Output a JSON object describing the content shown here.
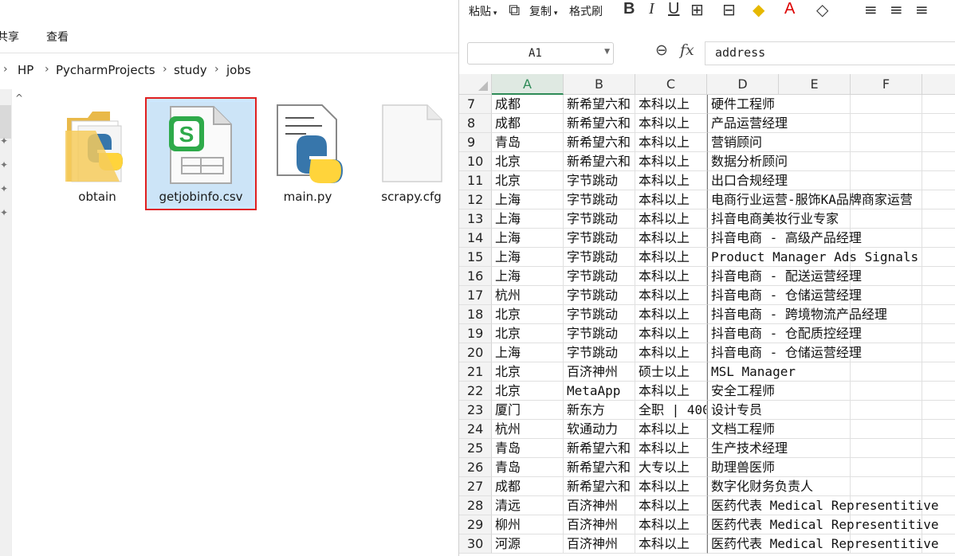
{
  "explorer": {
    "tabs": [
      "共享",
      "查看"
    ],
    "breadcrumb": [
      "HP",
      "PycharmProjects",
      "study",
      "jobs"
    ],
    "files": [
      {
        "name": "obtain",
        "icon": "python-folder-icon"
      },
      {
        "name": "getjobinfo.csv",
        "icon": "csv-spreadsheet-icon",
        "selected": true
      },
      {
        "name": "main.py",
        "icon": "python-file-icon"
      },
      {
        "name": "scrapy.cfg",
        "icon": "blank-file-icon"
      }
    ]
  },
  "spreadsheet": {
    "toolbar": {
      "paste": "粘贴",
      "copy": "复制",
      "format_painter": "格式刷"
    },
    "name_box": "A1",
    "formula_value": "address",
    "columns": [
      "A",
      "B",
      "C",
      "D",
      "E",
      "F"
    ],
    "rows": [
      {
        "n": "7",
        "a": "成都",
        "b": "新希望六和",
        "c": "本科以上",
        "d": "硬件工程师"
      },
      {
        "n": "8",
        "a": "成都",
        "b": "新希望六和",
        "c": "本科以上",
        "d": "产品运营经理"
      },
      {
        "n": "9",
        "a": "青岛",
        "b": "新希望六和",
        "c": "本科以上",
        "d": "营销顾问"
      },
      {
        "n": "10",
        "a": "北京",
        "b": "新希望六和",
        "c": "本科以上",
        "d": "数据分析顾问"
      },
      {
        "n": "11",
        "a": "北京",
        "b": "字节跳动",
        "c": "本科以上",
        "d": "出口合规经理"
      },
      {
        "n": "12",
        "a": "上海",
        "b": "字节跳动",
        "c": "本科以上",
        "d": "电商行业运营-服饰KA品牌商家运营"
      },
      {
        "n": "13",
        "a": "上海",
        "b": "字节跳动",
        "c": "本科以上",
        "d": "抖音电商美妆行业专家"
      },
      {
        "n": "14",
        "a": "上海",
        "b": "字节跳动",
        "c": "本科以上",
        "d": "抖音电商 - 高级产品经理"
      },
      {
        "n": "15",
        "a": "上海",
        "b": "字节跳动",
        "c": "本科以上",
        "d": "Product Manager  Ads Signals"
      },
      {
        "n": "16",
        "a": "上海",
        "b": "字节跳动",
        "c": "本科以上",
        "d": "抖音电商 - 配送运营经理"
      },
      {
        "n": "17",
        "a": "杭州",
        "b": "字节跳动",
        "c": "本科以上",
        "d": "抖音电商 - 仓储运营经理"
      },
      {
        "n": "18",
        "a": "北京",
        "b": "字节跳动",
        "c": "本科以上",
        "d": "抖音电商 - 跨境物流产品经理"
      },
      {
        "n": "19",
        "a": "北京",
        "b": "字节跳动",
        "c": "本科以上",
        "d": "抖音电商 - 仓配质控经理"
      },
      {
        "n": "20",
        "a": "上海",
        "b": "字节跳动",
        "c": "本科以上",
        "d": "抖音电商 - 仓储运营经理"
      },
      {
        "n": "21",
        "a": "北京",
        "b": "百济神州",
        "c": "硕士以上",
        "d": "MSL Manager"
      },
      {
        "n": "22",
        "a": "北京",
        "b": "MetaApp",
        "c": "本科以上",
        "d": "安全工程师"
      },
      {
        "n": "23",
        "a": "厦门",
        "b": "新东方",
        "c": "全职 | 400",
        "d": "设计专员"
      },
      {
        "n": "24",
        "a": "杭州",
        "b": "软通动力",
        "c": "本科以上",
        "d": "文档工程师"
      },
      {
        "n": "25",
        "a": "青岛",
        "b": "新希望六和",
        "c": "本科以上",
        "d": "生产技术经理"
      },
      {
        "n": "26",
        "a": "青岛",
        "b": "新希望六和",
        "c": "大专以上",
        "d": "助理兽医师"
      },
      {
        "n": "27",
        "a": "成都",
        "b": "新希望六和",
        "c": "本科以上",
        "d": "数字化财务负责人"
      },
      {
        "n": "28",
        "a": "清远",
        "b": "百济神州",
        "c": "本科以上",
        "d": "医药代表 Medical Representitive"
      },
      {
        "n": "29",
        "a": "柳州",
        "b": "百济神州",
        "c": "本科以上",
        "d": "医药代表 Medical Representitive"
      },
      {
        "n": "30",
        "a": "河源",
        "b": "百济神州",
        "c": "本科以上",
        "d": "医药代表 Medical Representitive"
      }
    ]
  }
}
